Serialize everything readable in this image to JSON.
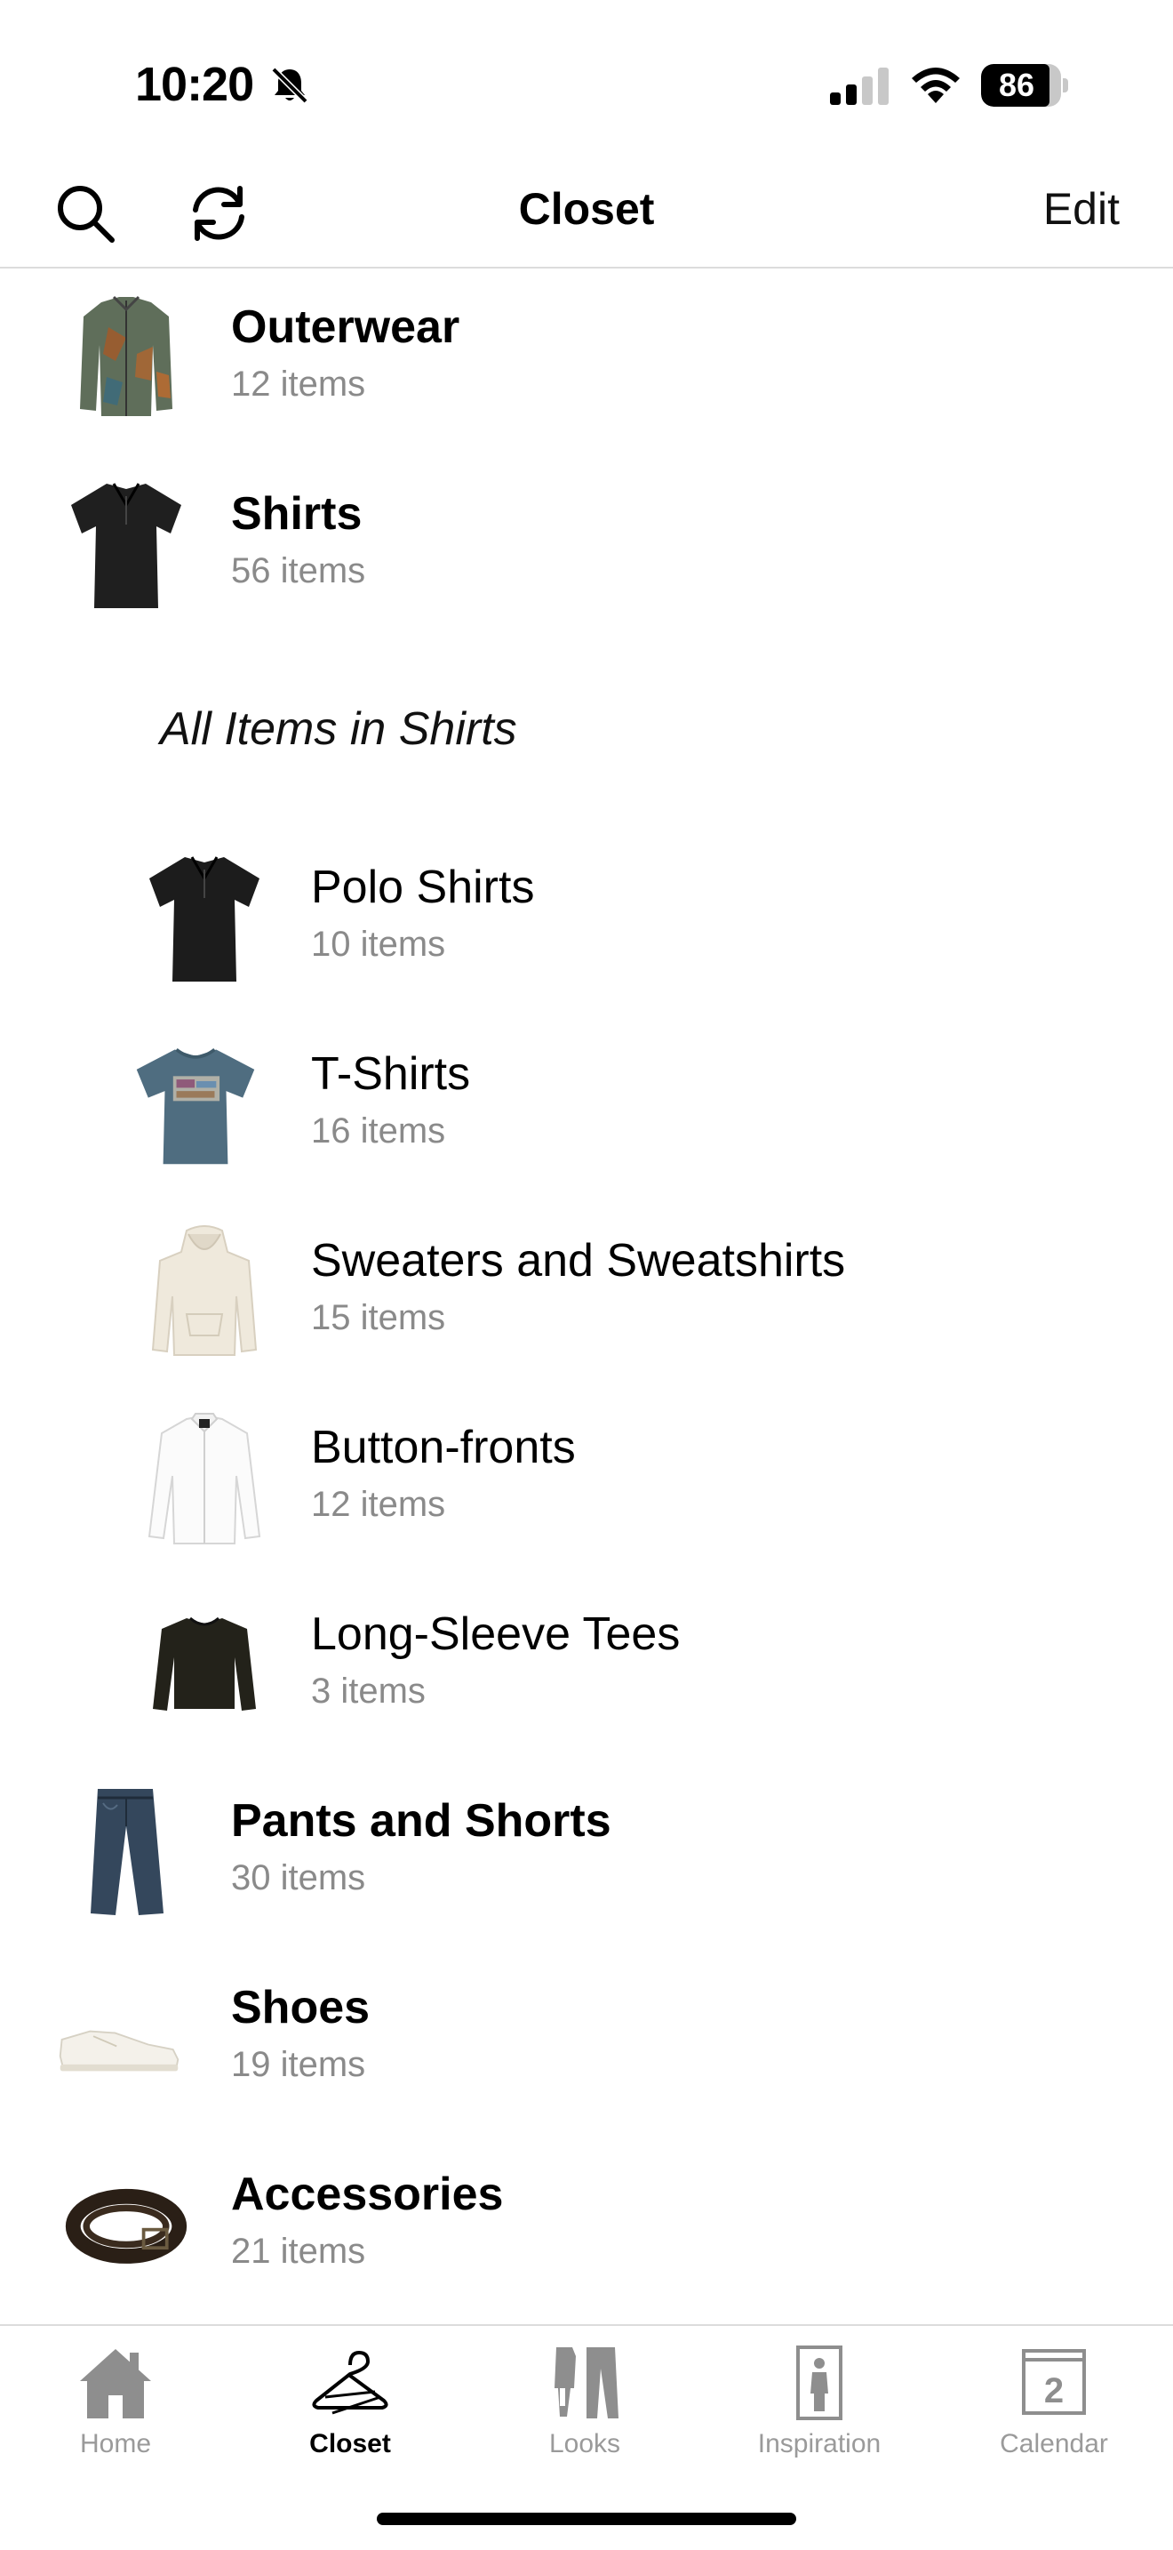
{
  "status_bar": {
    "time": "10:20",
    "battery_level": 86,
    "battery_text": "86",
    "signal_bars_filled": 2,
    "signal_bars_total": 4
  },
  "nav": {
    "title": "Closet",
    "edit_label": "Edit",
    "left_icons": [
      "search-icon",
      "refresh-icon"
    ]
  },
  "categories": [
    {
      "title": "Outerwear",
      "count": "12 items",
      "icon": "jacket-thumbnail"
    },
    {
      "title": "Shirts",
      "count": "56 items",
      "icon": "polo-thumbnail"
    }
  ],
  "shirts_section": {
    "heading": "All Items in Shirts",
    "items": [
      {
        "title": "Polo Shirts",
        "count": "10 items",
        "icon": "polo-thumbnail"
      },
      {
        "title": "T-Shirts",
        "count": "16 items",
        "icon": "tshirt-thumbnail"
      },
      {
        "title": "Sweaters and Sweatshirts",
        "count": "15 items",
        "icon": "hoodie-thumbnail"
      },
      {
        "title": "Button-fronts",
        "count": "12 items",
        "icon": "button-front-thumbnail"
      },
      {
        "title": "Long-Sleeve Tees",
        "count": "3 items",
        "icon": "longsleeve-thumbnail"
      }
    ]
  },
  "more_categories": [
    {
      "title": "Pants and Shorts",
      "count": "30 items",
      "icon": "jeans-thumbnail"
    },
    {
      "title": "Shoes",
      "count": "19 items",
      "icon": "sneaker-thumbnail"
    },
    {
      "title": "Accessories",
      "count": "21 items",
      "icon": "belt-thumbnail"
    }
  ],
  "tab_bar": {
    "active": "Closet",
    "tabs": [
      {
        "label": "Home",
        "icon": "home-icon"
      },
      {
        "label": "Closet",
        "icon": "hanger-icon"
      },
      {
        "label": "Looks",
        "icon": "looks-icon"
      },
      {
        "label": "Inspiration",
        "icon": "inspiration-icon"
      },
      {
        "label": "Calendar",
        "icon": "calendar-icon",
        "badge": "2"
      }
    ]
  },
  "colors": {
    "secondary_text": "#8a8a8a",
    "inactive_tab": "#9a9a9a",
    "divider": "#dcdcdc"
  }
}
